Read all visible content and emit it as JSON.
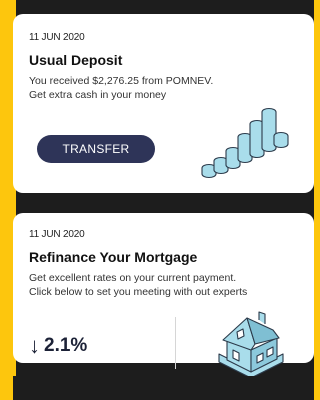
{
  "card_deposit": {
    "date": "11 JUN 2020",
    "title": "Usual Deposit",
    "line1": "You received $2,276.25 from POMNEV.",
    "line2": "Get extra cash in your money",
    "button_label": "TRANSFER"
  },
  "card_mortgage": {
    "date": "11 JUN 2020",
    "title": "Refinance Your Mortgage",
    "line1": "Get excellent rates on your current payment.",
    "line2": "Click below to set you meeting with out experts",
    "rate_arrow": "↓",
    "rate_value": "2.1%"
  },
  "colors": {
    "background": "#FDC60D",
    "button": "#2E3458",
    "illustration_accent": "#A9DDEB"
  },
  "icons": [
    "bar-chart-illustration-icon",
    "house-illustration-icon",
    "down-arrow-icon"
  ]
}
